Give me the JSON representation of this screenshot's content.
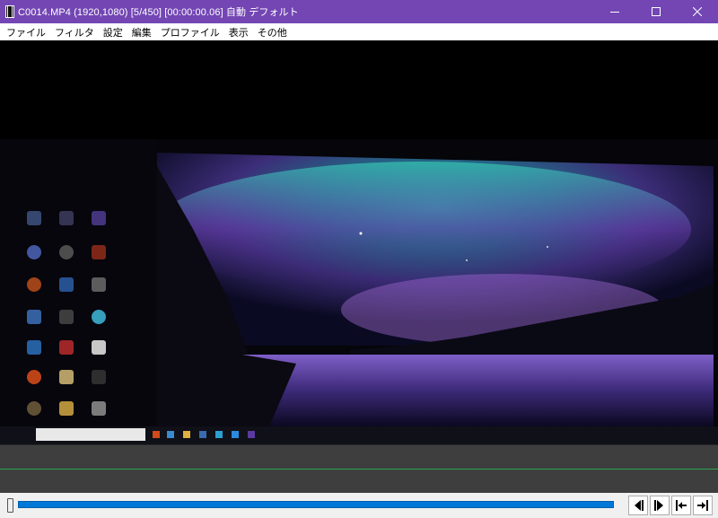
{
  "window": {
    "title": "C0014.MP4 (1920,1080)  [5/450] [00:00:00.06]  自動  デフォルト"
  },
  "menu": [
    "ファイル",
    "フィルタ",
    "設定",
    "編集",
    "プロファイル",
    "表示",
    "その他"
  ],
  "playback": {
    "current_frame": 5,
    "total_frames": 450
  },
  "colors": {
    "titlebar": "#7346b4",
    "seek_fill": "#0078d7",
    "timeline_bg": "#3e3e3e",
    "timeline_line": "#2ea44f"
  },
  "controls": {
    "prev_frame": "step-back-icon",
    "next_frame": "step-forward-icon",
    "go_start": "skip-to-start-icon",
    "go_end": "skip-to-end-icon"
  }
}
